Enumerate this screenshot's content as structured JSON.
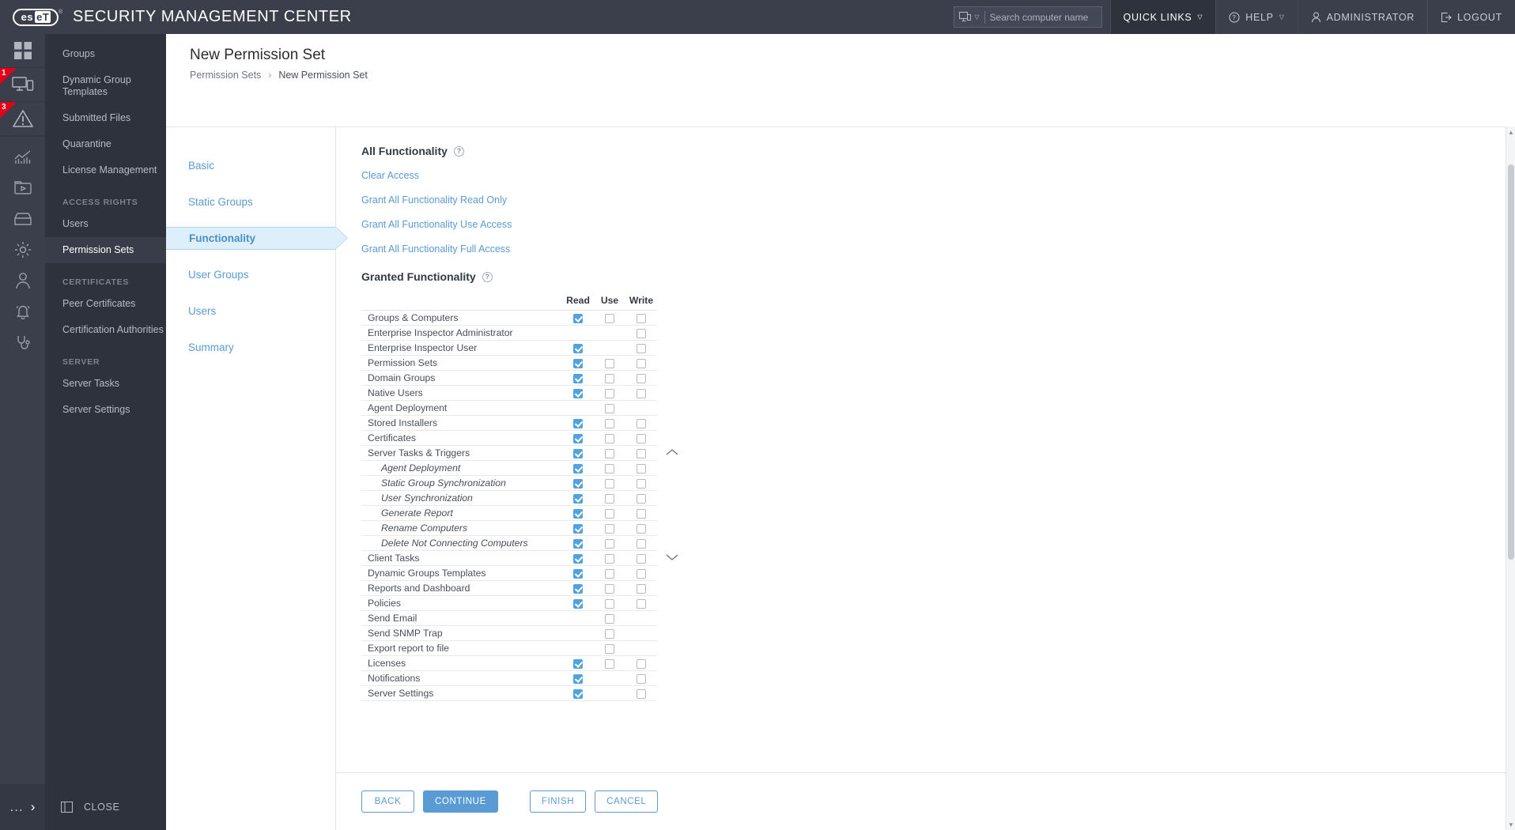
{
  "topbar": {
    "logo_left": "es",
    "logo_right": "eT",
    "registered": "®",
    "app_title": "SECURITY MANAGEMENT CENTER",
    "search_placeholder": "Search computer name",
    "search_value": "",
    "quick_links": "QUICK LINKS",
    "help": "HELP",
    "administrator": "ADMINISTRATOR",
    "logout": "LOGOUT"
  },
  "rail": {
    "badges": {
      "computers": "1",
      "alerts": "3"
    },
    "items": [
      {
        "icon": "dashboard-icon"
      },
      {
        "icon": "computers-icon"
      },
      {
        "icon": "detections-icon"
      },
      {
        "icon": "reports-icon"
      },
      {
        "icon": "tasks-icon"
      },
      {
        "icon": "installers-icon"
      },
      {
        "icon": "policies-icon"
      },
      {
        "icon": "users-icon"
      },
      {
        "icon": "notifications-icon"
      },
      {
        "icon": "status-overview-icon"
      }
    ],
    "more": "...",
    "expand": "›"
  },
  "nav": {
    "items": [
      {
        "label": "Groups",
        "selected": false
      },
      {
        "label": "Dynamic Group Templates",
        "selected": false
      },
      {
        "label": "Submitted Files",
        "selected": false
      },
      {
        "label": "Quarantine",
        "selected": false
      },
      {
        "label": "License Management",
        "selected": false
      }
    ],
    "group_access_rights": "ACCESS RIGHTS",
    "access_rights_items": [
      {
        "label": "Users",
        "selected": false
      },
      {
        "label": "Permission Sets",
        "selected": true
      }
    ],
    "group_certificates": "CERTIFICATES",
    "certificates_items": [
      {
        "label": "Peer Certificates",
        "selected": false
      },
      {
        "label": "Certification Authorities",
        "selected": false
      }
    ],
    "group_server": "SERVER",
    "server_items": [
      {
        "label": "Server Tasks",
        "selected": false
      },
      {
        "label": "Server Settings",
        "selected": false
      }
    ],
    "close_label": "CLOSE"
  },
  "page": {
    "title": "New Permission Set",
    "breadcrumb_parent": "Permission Sets",
    "breadcrumb_separator": "›",
    "breadcrumb_current": "New Permission Set"
  },
  "steps": [
    {
      "label": "Basic",
      "active": false
    },
    {
      "label": "Static Groups",
      "active": false
    },
    {
      "label": "Functionality",
      "active": true
    },
    {
      "label": "User Groups",
      "active": false
    },
    {
      "label": "Users",
      "active": false
    },
    {
      "label": "Summary",
      "active": false
    }
  ],
  "all_functionality": {
    "title": "All Functionality",
    "help": "?",
    "links": [
      "Clear Access",
      "Grant All Functionality Read Only",
      "Grant All Functionality Use Access",
      "Grant All Functionality Full Access"
    ]
  },
  "granted_functionality": {
    "title": "Granted Functionality",
    "help": "?",
    "columns": [
      "",
      "Read",
      "Use",
      "Write",
      ""
    ],
    "rows": [
      {
        "name": "Groups & Computers",
        "sub": false,
        "read": true,
        "use": false,
        "write": false,
        "has_read": true,
        "has_use": true,
        "has_write": true,
        "expander": ""
      },
      {
        "name": "Enterprise Inspector Administrator",
        "sub": false,
        "read": false,
        "use": false,
        "write": false,
        "has_read": false,
        "has_use": false,
        "has_write": true,
        "expander": ""
      },
      {
        "name": "Enterprise Inspector User",
        "sub": false,
        "read": true,
        "use": false,
        "write": false,
        "has_read": true,
        "has_use": false,
        "has_write": true,
        "expander": ""
      },
      {
        "name": "Permission Sets",
        "sub": false,
        "read": true,
        "use": false,
        "write": false,
        "has_read": true,
        "has_use": true,
        "has_write": true,
        "expander": ""
      },
      {
        "name": "Domain Groups",
        "sub": false,
        "read": true,
        "use": false,
        "write": false,
        "has_read": true,
        "has_use": true,
        "has_write": true,
        "expander": ""
      },
      {
        "name": "Native Users",
        "sub": false,
        "read": true,
        "use": false,
        "write": false,
        "has_read": true,
        "has_use": true,
        "has_write": true,
        "expander": ""
      },
      {
        "name": "Agent Deployment",
        "sub": false,
        "read": false,
        "use": false,
        "write": false,
        "has_read": false,
        "has_use": true,
        "has_write": false,
        "expander": ""
      },
      {
        "name": "Stored Installers",
        "sub": false,
        "read": true,
        "use": false,
        "write": false,
        "has_read": true,
        "has_use": true,
        "has_write": true,
        "expander": ""
      },
      {
        "name": "Certificates",
        "sub": false,
        "read": true,
        "use": false,
        "write": false,
        "has_read": true,
        "has_use": true,
        "has_write": true,
        "expander": ""
      },
      {
        "name": "Server Tasks & Triggers",
        "sub": false,
        "read": true,
        "use": false,
        "write": false,
        "has_read": true,
        "has_use": true,
        "has_write": true,
        "expander": "collapse"
      },
      {
        "name": "Agent Deployment",
        "sub": true,
        "read": true,
        "use": false,
        "write": false,
        "has_read": true,
        "has_use": true,
        "has_write": true,
        "expander": ""
      },
      {
        "name": "Static Group Synchronization",
        "sub": true,
        "read": true,
        "use": false,
        "write": false,
        "has_read": true,
        "has_use": true,
        "has_write": true,
        "expander": ""
      },
      {
        "name": "User Synchronization",
        "sub": true,
        "read": true,
        "use": false,
        "write": false,
        "has_read": true,
        "has_use": true,
        "has_write": true,
        "expander": ""
      },
      {
        "name": "Generate Report",
        "sub": true,
        "read": true,
        "use": false,
        "write": false,
        "has_read": true,
        "has_use": true,
        "has_write": true,
        "expander": ""
      },
      {
        "name": "Rename Computers",
        "sub": true,
        "read": true,
        "use": false,
        "write": false,
        "has_read": true,
        "has_use": true,
        "has_write": true,
        "expander": ""
      },
      {
        "name": "Delete Not Connecting Computers",
        "sub": true,
        "read": true,
        "use": false,
        "write": false,
        "has_read": true,
        "has_use": true,
        "has_write": true,
        "expander": ""
      },
      {
        "name": "Client Tasks",
        "sub": false,
        "read": true,
        "use": false,
        "write": false,
        "has_read": true,
        "has_use": true,
        "has_write": true,
        "expander": "expand"
      },
      {
        "name": "Dynamic Groups Templates",
        "sub": false,
        "read": true,
        "use": false,
        "write": false,
        "has_read": true,
        "has_use": true,
        "has_write": true,
        "expander": ""
      },
      {
        "name": "Reports and Dashboard",
        "sub": false,
        "read": true,
        "use": false,
        "write": false,
        "has_read": true,
        "has_use": true,
        "has_write": true,
        "expander": ""
      },
      {
        "name": "Policies",
        "sub": false,
        "read": true,
        "use": false,
        "write": false,
        "has_read": true,
        "has_use": true,
        "has_write": true,
        "expander": ""
      },
      {
        "name": "Send Email",
        "sub": false,
        "read": false,
        "use": false,
        "write": false,
        "has_read": false,
        "has_use": true,
        "has_write": false,
        "expander": ""
      },
      {
        "name": "Send SNMP Trap",
        "sub": false,
        "read": false,
        "use": false,
        "write": false,
        "has_read": false,
        "has_use": true,
        "has_write": false,
        "expander": ""
      },
      {
        "name": "Export report to file",
        "sub": false,
        "read": false,
        "use": false,
        "write": false,
        "has_read": false,
        "has_use": true,
        "has_write": false,
        "expander": ""
      },
      {
        "name": "Licenses",
        "sub": false,
        "read": true,
        "use": false,
        "write": false,
        "has_read": true,
        "has_use": true,
        "has_write": true,
        "expander": ""
      },
      {
        "name": "Notifications",
        "sub": false,
        "read": true,
        "use": false,
        "write": false,
        "has_read": true,
        "has_use": false,
        "has_write": true,
        "expander": ""
      },
      {
        "name": "Server Settings",
        "sub": false,
        "read": true,
        "use": false,
        "write": false,
        "has_read": true,
        "has_use": false,
        "has_write": true,
        "expander": ""
      }
    ]
  },
  "footer": {
    "back": "BACK",
    "continue": "CONTINUE",
    "finish": "FINISH",
    "cancel": "CANCEL"
  },
  "colors": {
    "accent": "#5b9bd5",
    "checkbox_on": "#50a2e0",
    "dark_bar": "#3a3f4b",
    "nav_panel": "#2d323c",
    "badge_red": "#e2001a"
  }
}
